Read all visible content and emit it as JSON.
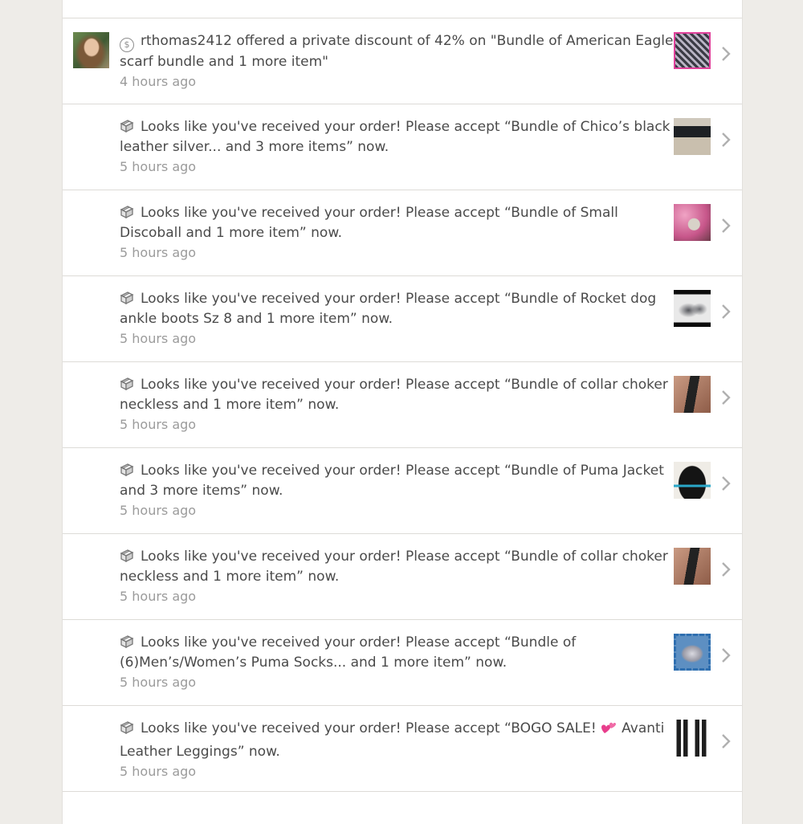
{
  "notifications": [
    {
      "type": "discount",
      "icon": "dollar-coin-icon",
      "message": "rthomas2412 offered a private discount of 42% on \"Bundle of American Eagle scarf bundle and 1 more item\"",
      "time": "4 hours ago",
      "thumbnail": "scarf-photo"
    },
    {
      "type": "order",
      "icon": "package-icon",
      "message": "Looks like you've received your order! Please accept “Bundle of Chico’s black leather silver... and 3 more items” now.",
      "time": "5 hours ago",
      "thumbnail": "leather-belt-photo"
    },
    {
      "type": "order",
      "icon": "package-icon",
      "message": "Looks like you've received your order! Please accept “Bundle of Small Discoball and 1 more item” now.",
      "time": "5 hours ago",
      "thumbnail": "discoball-photo"
    },
    {
      "type": "order",
      "icon": "package-icon",
      "message": "Looks like you've received your order! Please accept “Bundle of Rocket dog ankle boots Sz 8 and 1 more item” now.",
      "time": "5 hours ago",
      "thumbnail": "ankle-boots-photo"
    },
    {
      "type": "order",
      "icon": "package-icon",
      "message": "Looks like you've received your order! Please accept “Bundle of collar choker neckless and 1 more item” now.",
      "time": "5 hours ago",
      "thumbnail": "choker-photo"
    },
    {
      "type": "order",
      "icon": "package-icon",
      "message": "Looks like you've received your order! Please accept “Bundle of Puma Jacket and 3 more items” now.",
      "time": "5 hours ago",
      "thumbnail": "puma-jacket-photo"
    },
    {
      "type": "order",
      "icon": "package-icon",
      "message": "Looks like you've received your order! Please accept “Bundle of collar choker neckless and 1 more item” now.",
      "time": "5 hours ago",
      "thumbnail": "choker-photo"
    },
    {
      "type": "order",
      "icon": "package-icon",
      "message": "Looks like you've received your order! Please accept “Bundle of (6)Men’s/Women’s Puma Socks... and 1 more item” now.",
      "time": "5 hours ago",
      "thumbnail": "socks-photo"
    },
    {
      "type": "order",
      "icon": "package-icon",
      "message_before_emoji": "Looks like you've received your order! Please accept “BOGO SALE!",
      "emoji": "two-hearts-emoji",
      "message_after_emoji": " Avanti Leather Leggings” now.",
      "time": "5 hours ago",
      "thumbnail": "leggings-photo"
    }
  ],
  "colors": {
    "background": "#eeece8",
    "card": "#ffffff",
    "text": "#4a4a4a",
    "timestamp": "#9b9b9b",
    "divider": "#dddbd7"
  }
}
